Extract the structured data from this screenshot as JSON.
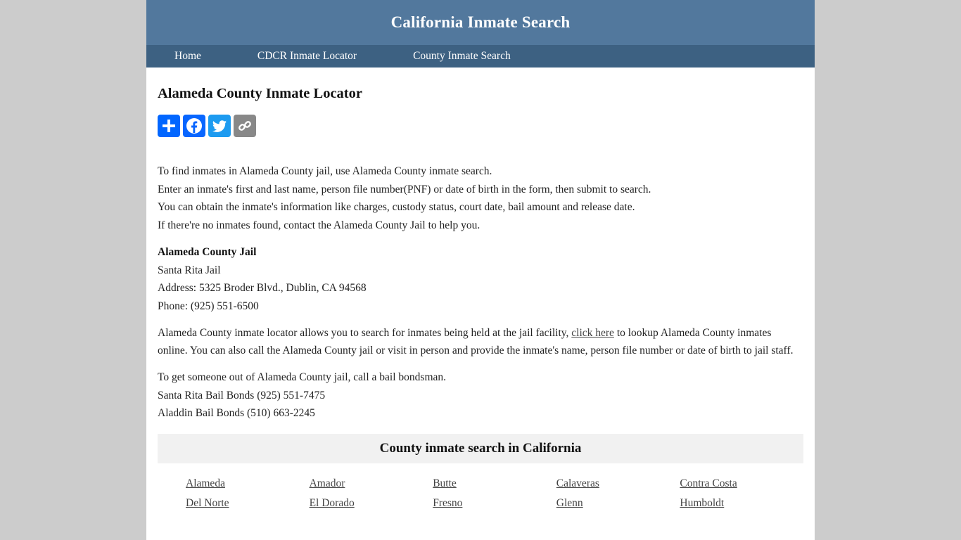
{
  "header": {
    "title": "California Inmate Search"
  },
  "nav": {
    "items": [
      {
        "label": "Home"
      },
      {
        "label": "CDCR Inmate Locator"
      },
      {
        "label": "County Inmate Search"
      }
    ]
  },
  "main": {
    "title": "Alameda County Inmate Locator",
    "share": {
      "buttons": [
        {
          "name": "share",
          "icon": "plus-icon",
          "color": "#0166ff"
        },
        {
          "name": "facebook",
          "icon": "facebook-icon",
          "color": "#0866ff"
        },
        {
          "name": "twitter",
          "icon": "twitter-icon",
          "color": "#1d9bf0"
        },
        {
          "name": "copy-link",
          "icon": "link-icon",
          "color": "#888888"
        }
      ]
    },
    "intro": [
      "To find inmates in Alameda County jail, use Alameda County inmate search.",
      "Enter an inmate's first and last name, person file number(PNF) or date of birth in the form, then submit to search.",
      "You can obtain the inmate's information like charges, custody status, court date, bail amount and release date.",
      "If there're no inmates found, contact the Alameda County Jail to help you."
    ],
    "jail": {
      "title": "Alameda County Jail",
      "name": "Santa Rita Jail",
      "address": "Address: 5325 Broder Blvd., Dublin, CA 94568",
      "phone": "Phone: (925) 551-6500"
    },
    "locator": {
      "before": "Alameda County inmate locator allows you to search for inmates being held at the jail facility, ",
      "link": "click here",
      "after": " to lookup Alameda County inmates online. You can also call the Alameda County jail or visit in person and provide the inmate's name, person file number or date of birth to jail staff."
    },
    "bail": [
      "To get someone out of Alameda County jail, call a bail bondsman.",
      "Santa Rita Bail Bonds (925) 551-7475",
      "Aladdin Bail Bonds (510) 663-2245"
    ],
    "counties": {
      "title": "County inmate search in California",
      "items": [
        "Alameda",
        "Amador",
        "Butte",
        "Calaveras",
        "Contra Costa",
        "Del Norte",
        "El Dorado",
        "Fresno",
        "Glenn",
        "Humboldt"
      ]
    }
  }
}
